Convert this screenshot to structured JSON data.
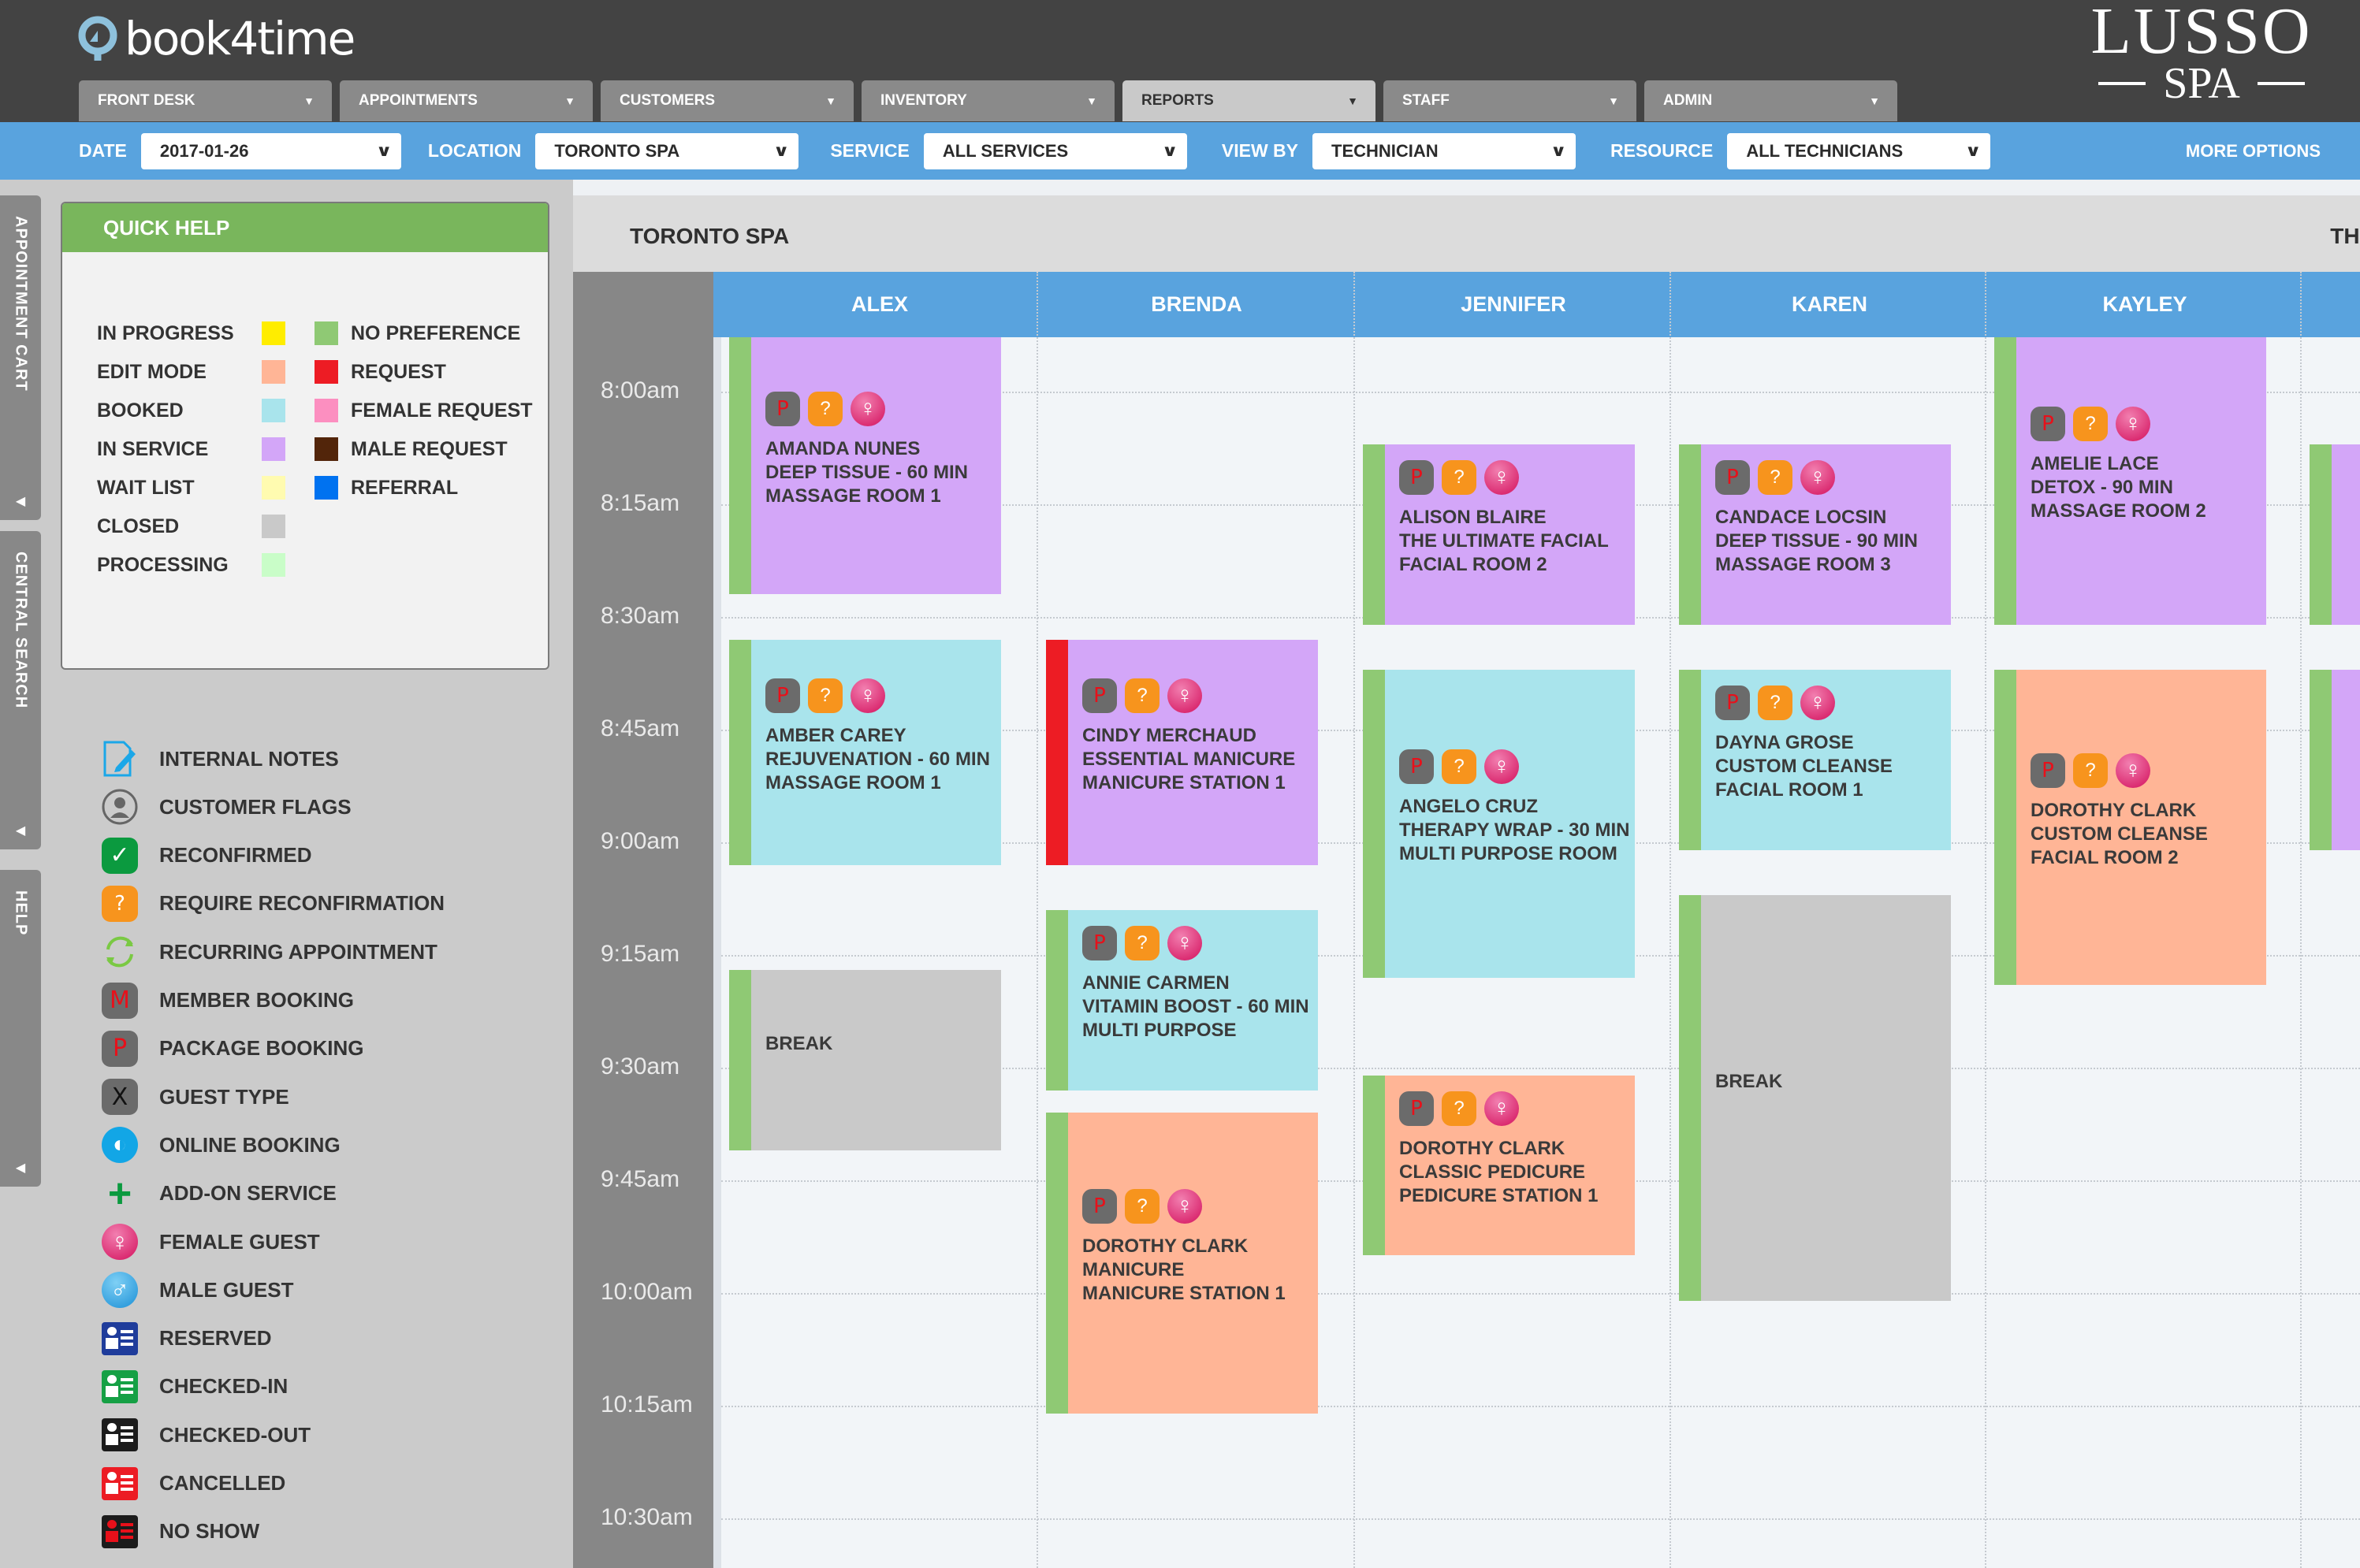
{
  "app": {
    "logo_text": "book4time",
    "brand_line1": "LUSSO",
    "brand_line2": "SPA"
  },
  "nav": {
    "tabs": [
      {
        "label": "FRONT DESK"
      },
      {
        "label": "APPOINTMENTS"
      },
      {
        "label": "CUSTOMERS"
      },
      {
        "label": "INVENTORY"
      },
      {
        "label": "REPORTS",
        "active": true
      },
      {
        "label": "STAFF"
      },
      {
        "label": "ADMIN"
      }
    ]
  },
  "filters": {
    "date_label": "DATE",
    "date_value": "2017-01-26",
    "location_label": "LOCATION",
    "location_value": "TORONTO SPA",
    "service_label": "SERVICE",
    "service_value": "ALL SERVICES",
    "viewby_label": "VIEW BY",
    "viewby_value": "TECHNICIAN",
    "resource_label": "RESOURCE",
    "resource_value": "ALL TECHNICIANS",
    "more_options": "MORE OPTIONS"
  },
  "side_tabs": [
    "APPOINTMENT CART",
    "CENTRAL SEARCH",
    "HELP"
  ],
  "quick_help": {
    "title": "QUICK HELP",
    "status_legend": [
      {
        "label": "IN PROGRESS",
        "color": "#ffed00"
      },
      {
        "label": "EDIT MODE",
        "color": "#ffb596"
      },
      {
        "label": "BOOKED",
        "color": "#a9e4ec"
      },
      {
        "label": "IN SERVICE",
        "color": "#d3a6f8"
      },
      {
        "label": "WAIT LIST",
        "color": "#fffbb0"
      },
      {
        "label": "CLOSED",
        "color": "#c9c9c9"
      },
      {
        "label": "PROCESSING",
        "color": "#c9fdc8"
      }
    ],
    "request_legend": [
      {
        "label": "NO PREFERENCE",
        "color": "#8fc974"
      },
      {
        "label": "REQUEST",
        "color": "#ed1c24"
      },
      {
        "label": "FEMALE REQUEST",
        "color": "#fc8fc0"
      },
      {
        "label": "MALE REQUEST",
        "color": "#52250a"
      },
      {
        "label": "REFERRAL",
        "color": "#0072f0"
      }
    ]
  },
  "icon_legend": [
    {
      "icon": "internal-notes-icon",
      "label": "INTERNAL NOTES"
    },
    {
      "icon": "customer-flags-icon",
      "label": "CUSTOMER FLAGS"
    },
    {
      "icon": "reconfirmed-icon",
      "label": "RECONFIRMED"
    },
    {
      "icon": "require-reconfirmation-icon",
      "label": "REQUIRE RECONFIRMATION"
    },
    {
      "icon": "recurring-icon",
      "label": "RECURRING APPOINTMENT"
    },
    {
      "icon": "member-booking-icon",
      "label": "MEMBER BOOKING"
    },
    {
      "icon": "package-booking-icon",
      "label": "PACKAGE BOOKING"
    },
    {
      "icon": "guest-type-icon",
      "label": "GUEST TYPE"
    },
    {
      "icon": "online-booking-icon",
      "label": "ONLINE BOOKING"
    },
    {
      "icon": "add-on-service-icon",
      "label": "ADD-ON SERVICE"
    },
    {
      "icon": "female-guest-icon",
      "label": "FEMALE GUEST"
    },
    {
      "icon": "male-guest-icon",
      "label": "MALE GUEST"
    },
    {
      "icon": "reserved-icon",
      "label": "RESERVED",
      "color": "#1f3c9b"
    },
    {
      "icon": "checked-in-icon",
      "label": "CHECKED-IN",
      "color": "#16a045"
    },
    {
      "icon": "checked-out-icon",
      "label": "CHECKED-OUT",
      "color": "#1c1c1c"
    },
    {
      "icon": "cancelled-icon",
      "label": "CANCELLED",
      "color": "#ec1c24"
    },
    {
      "icon": "no-show-icon",
      "label": "NO SHOW",
      "color": "#1c1c1c"
    }
  ],
  "calendar": {
    "location": "TORONTO SPA",
    "day_label": "THUR",
    "times": [
      "8:00am",
      "8:15am",
      "8:30am",
      "8:45am",
      "9:00am",
      "9:15am",
      "9:30am",
      "9:45am",
      "10:00am",
      "10:15am",
      "10:30am"
    ],
    "staff": [
      "ALEX",
      "BRENDA",
      "JENNIFER",
      "KAREN",
      "KAYLEY"
    ],
    "appointments": [
      {
        "staff": 0,
        "start": "7:52",
        "end": "8:27",
        "status": "in_service",
        "request": "no_preference",
        "badges": true,
        "lines": [
          "AMANDA NUNES",
          "DEEP TISSUE - 60 MIN",
          "MASSAGE ROOM 1"
        ]
      },
      {
        "staff": 0,
        "start": "8:33",
        "end": "9:03",
        "status": "booked",
        "request": "no_preference",
        "badges": true,
        "lines": [
          "AMBER CAREY",
          "REJUVENATION - 60 MIN",
          "MASSAGE ROOM 1"
        ]
      },
      {
        "staff": 0,
        "start": "9:17",
        "end": "9:41",
        "status": "closed",
        "request": "no_preference",
        "badges": false,
        "lines": [
          "BREAK"
        ]
      },
      {
        "staff": 1,
        "start": "8:33",
        "end": "9:03",
        "status": "in_service",
        "request": "request",
        "badges": true,
        "lines": [
          "CINDY MERCHAUD",
          "ESSENTIAL MANICURE",
          "MANICURE STATION 1"
        ]
      },
      {
        "staff": 1,
        "start": "9:09",
        "end": "9:33",
        "status": "booked",
        "request": "no_preference",
        "badges": true,
        "lines": [
          "ANNIE CARMEN",
          "VITAMIN BOOST - 60 MIN",
          "MULTI PURPOSE"
        ]
      },
      {
        "staff": 1,
        "start": "9:36",
        "end": "10:16",
        "status": "edit_mode",
        "request": "no_preference",
        "badges": true,
        "lines": [
          "DOROTHY CLARK",
          "MANICURE",
          "MANICURE STATION 1"
        ]
      },
      {
        "staff": 2,
        "start": "8:07",
        "end": "8:31",
        "status": "in_service",
        "request": "no_preference",
        "badges": true,
        "lines": [
          "ALISON BLAIRE",
          "THE ULTIMATE FACIAL",
          "FACIAL ROOM 2"
        ]
      },
      {
        "staff": 2,
        "start": "8:37",
        "end": "9:18",
        "status": "booked",
        "request": "no_preference",
        "badges": true,
        "lines": [
          "ANGELO CRUZ",
          "THERAPY WRAP - 30 MIN",
          "MULTI PURPOSE ROOM"
        ]
      },
      {
        "staff": 2,
        "start": "9:31",
        "end": "9:55",
        "status": "edit_mode",
        "request": "no_preference",
        "badges": true,
        "lines": [
          "DOROTHY CLARK",
          "CLASSIC PEDICURE",
          "PEDICURE STATION 1"
        ]
      },
      {
        "staff": 3,
        "start": "8:07",
        "end": "8:31",
        "status": "in_service",
        "request": "no_preference",
        "badges": true,
        "lines": [
          "CANDACE LOCSIN",
          "DEEP TISSUE - 90 MIN",
          "MASSAGE ROOM 3"
        ]
      },
      {
        "staff": 3,
        "start": "8:37",
        "end": "9:01",
        "status": "booked",
        "request": "no_preference",
        "badges": true,
        "lines": [
          "DAYNA GROSE",
          "CUSTOM CLEANSE",
          "FACIAL ROOM 1"
        ]
      },
      {
        "staff": 3,
        "start": "9:07",
        "end": "10:01",
        "status": "closed",
        "request": "no_preference",
        "badges": false,
        "lines": [
          "BREAK"
        ]
      },
      {
        "staff": 4,
        "start": "7:52",
        "end": "8:31",
        "status": "in_service",
        "request": "no_preference",
        "badges": true,
        "lines": [
          "AMELIE LACE",
          "DETOX - 90 MIN",
          "MASSAGE ROOM 2"
        ]
      },
      {
        "staff": 4,
        "start": "8:37",
        "end": "9:19",
        "status": "edit_mode",
        "request": "no_preference",
        "badges": true,
        "lines": [
          "DOROTHY CLARK",
          "CUSTOM CLEANSE",
          "FACIAL ROOM 2"
        ]
      },
      {
        "staff": 5,
        "start": "8:07",
        "end": "8:31",
        "status": "in_service",
        "request": "no_preference",
        "badges": false,
        "lines": []
      },
      {
        "staff": 5,
        "start": "8:37",
        "end": "9:01",
        "status": "in_service",
        "request": "no_preference",
        "badges": false,
        "lines": []
      }
    ]
  },
  "colors": {
    "in_service": "#d3a6f8",
    "booked": "#a9e4ec",
    "edit_mode": "#ffb596",
    "closed": "#c9c9c9",
    "no_preference": "#8fc974",
    "request": "#ed1c24",
    "accent_blue": "#59a3de"
  },
  "badge_glyphs": {
    "package": "P",
    "reconfirm": "?",
    "female": "♀"
  }
}
